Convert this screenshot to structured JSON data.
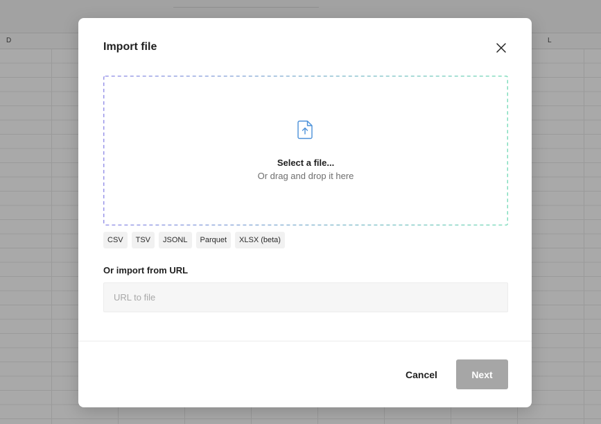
{
  "spreadsheet": {
    "column_headers": [
      "D",
      "L"
    ]
  },
  "dialog": {
    "title": "Import file",
    "close_icon": "close-icon",
    "dropzone": {
      "icon": "file-upload-icon",
      "primary_text": "Select a file...",
      "secondary_text": "Or drag and drop it here",
      "border_gradient": [
        "#8a86e6",
        "#6fd8b4"
      ]
    },
    "formats": [
      "CSV",
      "TSV",
      "JSONL",
      "Parquet",
      "XLSX (beta)"
    ],
    "url_section": {
      "label": "Or import from URL",
      "placeholder": "URL to file",
      "value": ""
    },
    "footer": {
      "cancel_label": "Cancel",
      "next_label": "Next",
      "next_disabled": true
    }
  },
  "colors": {
    "accent_icon": "#4a90d9",
    "disabled_button": "#a6a6a6"
  }
}
